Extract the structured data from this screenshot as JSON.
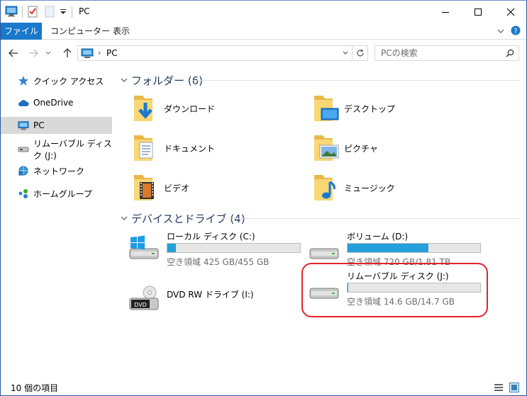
{
  "window": {
    "title": "PC",
    "controls": {
      "minimize": "minimize-icon",
      "maximize": "maximize-icon",
      "close": "close-icon"
    }
  },
  "quick_access_toolbar": [
    "computer-icon",
    "properties-checkmark-icon",
    "new-folder-icon",
    "customize-dropdown-icon"
  ],
  "ribbon": {
    "tabs": [
      {
        "label": "ファイル",
        "active": true
      },
      {
        "label": "コンピューター",
        "active": false
      },
      {
        "label": "表示",
        "active": false
      }
    ],
    "help_icon": "help-icon"
  },
  "address": {
    "path_segment": "PC",
    "search_placeholder": "PCの検索"
  },
  "nav_pane": {
    "items": [
      {
        "label": "クイック アクセス",
        "icon": "star-icon"
      },
      {
        "label": "OneDrive",
        "icon": "cloud-icon"
      },
      {
        "label": "PC",
        "icon": "pc-icon",
        "selected": true
      },
      {
        "label": "リムーバブル ディスク (J:)",
        "icon": "removable-drive-icon"
      },
      {
        "label": "ネットワーク",
        "icon": "network-icon"
      },
      {
        "label": "ホームグループ",
        "icon": "homegroup-icon"
      }
    ]
  },
  "folders_group": {
    "header": "フォルダー (6)",
    "items": [
      {
        "label": "ダウンロード",
        "icon": "downloads-folder-icon"
      },
      {
        "label": "デスクトップ",
        "icon": "desktop-folder-icon"
      },
      {
        "label": "ドキュメント",
        "icon": "documents-folder-icon"
      },
      {
        "label": "ピクチャ",
        "icon": "pictures-folder-icon"
      },
      {
        "label": "ビデオ",
        "icon": "videos-folder-icon"
      },
      {
        "label": "ミュージック",
        "icon": "music-folder-icon"
      }
    ]
  },
  "drives_group": {
    "header": "デバイスとドライブ (4)",
    "items": [
      {
        "name": "ローカル ディスク (C:)",
        "free": "空き領域 425 GB/455 GB",
        "used_fraction": 0.066,
        "icon": "windows-drive-icon"
      },
      {
        "name": "ボリューム (D:)",
        "free": "空き領域 720 GB/1.81 TB",
        "used_fraction": 0.61,
        "icon": "hard-drive-icon"
      },
      {
        "name": "DVD RW ドライブ (I:)",
        "icon": "dvd-drive-icon"
      },
      {
        "name": "リムーバブル ディスク (J:)",
        "free": "空き領域 14.6 GB/14.7 GB",
        "used_fraction": 0.007,
        "icon": "removable-drive-icon"
      }
    ]
  },
  "status": {
    "item_count": "10 個の項目",
    "views": [
      "details-view-icon",
      "large-icons-view-icon"
    ]
  },
  "colors": {
    "accent": "#1979ca",
    "progress": "#26a0da",
    "highlight": "#e3222c",
    "group_header": "#1e395b"
  }
}
